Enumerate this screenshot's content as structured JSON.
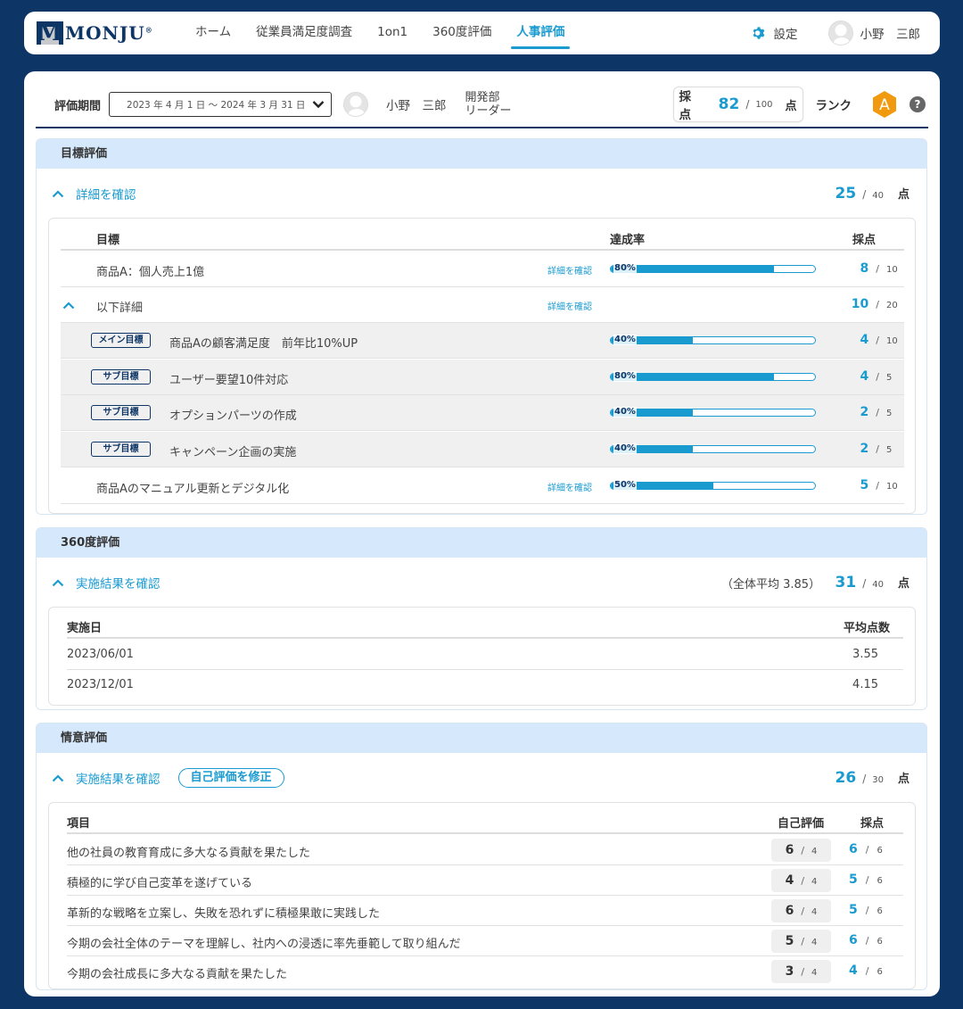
{
  "nav": {
    "logo": "MONJU",
    "logo_mark": "M",
    "registered": "®",
    "links": [
      "ホーム",
      "従業員満足度調査",
      "1on1",
      "360度評価",
      "人事評価"
    ],
    "active_index": 4,
    "settings": "設定",
    "user": "小野　三郎"
  },
  "header": {
    "period_label": "評価期間",
    "period_value": "2023 年 4 月 1 日 〜 2024 年 3 月 31 日",
    "employee_name": "小野　三郎",
    "department": "開発部",
    "role": "リーダー",
    "score_label": "採点",
    "score": "82",
    "score_max": "100",
    "score_unit": "点",
    "rank_label": "ランク",
    "rank": "A",
    "help": "?"
  },
  "goal": {
    "title": "目標評価",
    "toggle": "詳細を確認",
    "total": "25",
    "max": "40",
    "unit": "点",
    "columns": [
      "目標",
      "達成率",
      "採点"
    ],
    "detail_link": "詳細を確認",
    "rows": [
      {
        "label": "商品A：個人売上1億",
        "pct_label": "80%",
        "pct": 0.8,
        "score": "8",
        "max": "10"
      },
      {
        "label": "以下詳細",
        "score": "10",
        "max": "20"
      },
      {
        "tag": "メイン目標",
        "label": "商品Aの顧客満足度　前年比10%UP",
        "pct_label": "40%",
        "pct": 0.4,
        "score": "4",
        "max": "10"
      },
      {
        "tag": "サブ目標",
        "label": "ユーザー要望10件対応",
        "pct_label": "80%",
        "pct": 0.8,
        "score": "4",
        "max": "5"
      },
      {
        "tag": "サブ目標",
        "label": "オプションパーツの作成",
        "pct_label": "40%",
        "pct": 0.4,
        "score": "2",
        "max": "5"
      },
      {
        "tag": "サブ目標",
        "label": "キャンペーン企画の実施",
        "pct_label": "40%",
        "pct": 0.4,
        "score": "2",
        "max": "5"
      },
      {
        "label": "商品Aのマニュアル更新とデジタル化",
        "pct_label": "50%",
        "pct": 0.5,
        "score": "5",
        "max": "10"
      }
    ]
  },
  "review360": {
    "title": "360度評価",
    "toggle": "実施結果を確認",
    "average_note": "（全体平均 3.85）",
    "total": "31",
    "max": "40",
    "unit": "点",
    "columns": [
      "実施日",
      "平均点数"
    ],
    "rows": [
      {
        "date": "2023/06/01",
        "avg": "3.55"
      },
      {
        "date": "2023/12/01",
        "avg": "4.15"
      }
    ]
  },
  "emotion": {
    "title": "情意評価",
    "toggle": "実施結果を確認",
    "edit_button": "自己評価を修正",
    "total": "26",
    "max": "30",
    "unit": "点",
    "columns": [
      "項目",
      "自己評価",
      "採点"
    ],
    "rows": [
      {
        "label": "他の社員の教育育成に多大なる貢献を果たした",
        "self": "6",
        "self_max": "4",
        "score": "6",
        "max": "6"
      },
      {
        "label": "積極的に学び自己変革を遂げている",
        "self": "4",
        "self_max": "4",
        "score": "5",
        "max": "6"
      },
      {
        "label": "革新的な戦略を立案し、失敗を恐れずに積極果敢に実践した",
        "self": "6",
        "self_max": "4",
        "score": "5",
        "max": "6"
      },
      {
        "label": "今期の会社全体のテーマを理解し、社内への浸透に率先垂範して取り組んだ",
        "self": "5",
        "self_max": "4",
        "score": "6",
        "max": "6"
      },
      {
        "label": "今期の会社成長に多大なる貢献を果たした",
        "self": "3",
        "self_max": "4",
        "score": "4",
        "max": "6"
      }
    ]
  },
  "colors": {
    "navy": "#0d3566",
    "accent": "#1a9bd0",
    "section_head": "#d6e8fb",
    "rank": "#f29a0f"
  }
}
